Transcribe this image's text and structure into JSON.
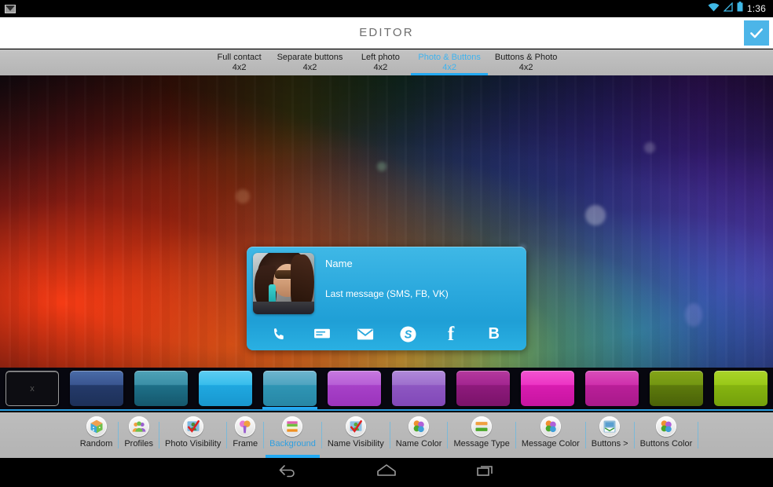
{
  "status_bar": {
    "notification_icon": "gmail-icon",
    "wifi_icon": "wifi-icon",
    "signal_icon": "signal-icon",
    "battery_icon": "battery-icon",
    "clock": "1:36"
  },
  "action_bar": {
    "title": "EDITOR",
    "confirm_icon": "check-icon",
    "confirm_color": "#4cb5e8"
  },
  "tabs": {
    "selected_index": 3,
    "accent_color": "#23a9f2",
    "items": [
      {
        "label": "Full contact",
        "size": "4x2"
      },
      {
        "label": "Separate buttons",
        "size": "4x2"
      },
      {
        "label": "Left photo",
        "size": "4x2"
      },
      {
        "label": "Photo & Buttons",
        "size": "4x2"
      },
      {
        "label": "Buttons & Photo",
        "size": "4x2"
      }
    ]
  },
  "widget": {
    "name": "Name",
    "message": "Last message (SMS, FB, VK)",
    "background_color": "#2aa8dd",
    "text_color": "#ffffff",
    "photo_alt": "contact-photo",
    "buttons": [
      {
        "icon": "phone-icon",
        "glyph": ""
      },
      {
        "icon": "sms-icon",
        "glyph": ""
      },
      {
        "icon": "email-icon",
        "glyph": ""
      },
      {
        "icon": "skype-icon",
        "glyph": "S"
      },
      {
        "icon": "facebook-icon",
        "glyph": "f"
      },
      {
        "icon": "vk-icon",
        "glyph": "B"
      }
    ]
  },
  "swatches": {
    "selected_index": 4,
    "items": [
      {
        "name": "none",
        "color": "#0d0d12",
        "label": "x"
      },
      {
        "name": "dark-blue",
        "color": "#2f4a82"
      },
      {
        "name": "teal",
        "color": "#2a8fa8"
      },
      {
        "name": "light-blue",
        "color": "#28b4ea"
      },
      {
        "name": "sky-blue",
        "color": "#3aa8cc"
      },
      {
        "name": "orchid",
        "color": "#b košt"
      },
      {
        "name": "violet",
        "color": "#9b59d0"
      },
      {
        "name": "magenta-dark",
        "color": "#a81f8f"
      },
      {
        "name": "magenta",
        "color": "#e41fc0"
      },
      {
        "name": "pink-magenta",
        "color": "#cc23a8"
      },
      {
        "name": "olive",
        "color": "#6f9412"
      },
      {
        "name": "lime",
        "color": "#8ec412"
      }
    ]
  },
  "toolbar": {
    "selected_index": 4,
    "accent_color": "#2f9fe0",
    "items": [
      {
        "label": "Random",
        "icon": "dice-icon"
      },
      {
        "label": "Profiles",
        "icon": "people-icon"
      },
      {
        "label": "Photo Visibility",
        "icon": "photo-visibility-icon"
      },
      {
        "label": "Frame",
        "icon": "frame-icon"
      },
      {
        "label": "Background",
        "icon": "background-icon"
      },
      {
        "label": "Name Visibility",
        "icon": "name-visibility-icon"
      },
      {
        "label": "Name Color",
        "icon": "color-palette-icon"
      },
      {
        "label": "Message Type",
        "icon": "message-type-icon"
      },
      {
        "label": "Message Color",
        "icon": "color-palette-icon"
      },
      {
        "label": "Buttons >",
        "icon": "buttons-icon"
      },
      {
        "label": "Buttons Color",
        "icon": "color-palette-icon"
      }
    ]
  },
  "nav_bar": {
    "back_icon": "back-icon",
    "home_icon": "home-icon",
    "recents_icon": "recents-icon"
  }
}
